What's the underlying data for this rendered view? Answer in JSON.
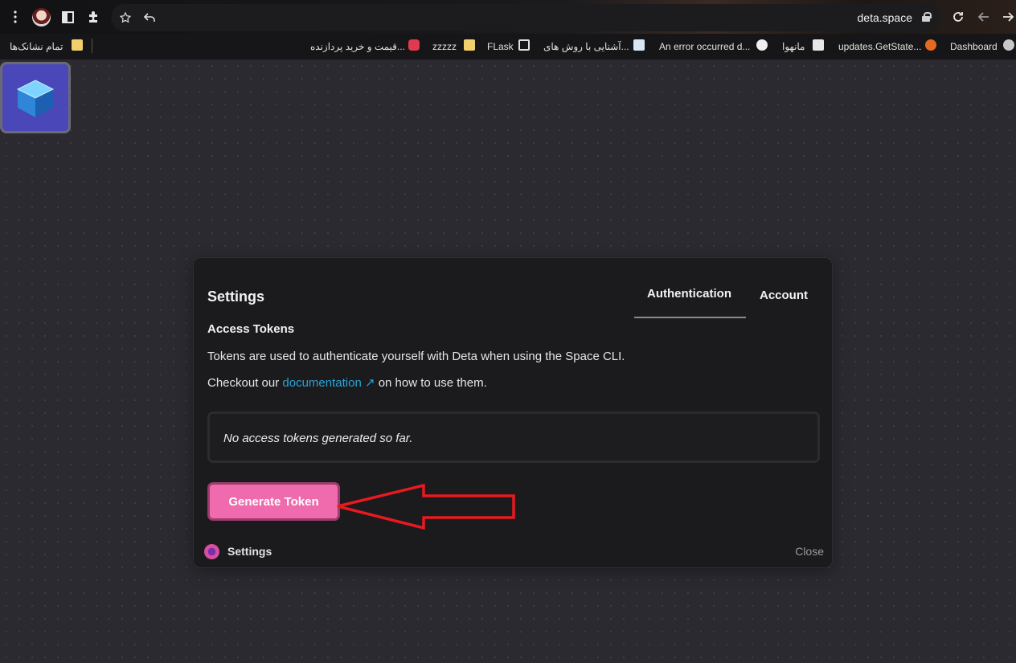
{
  "browser": {
    "url": "deta.space",
    "bookmarks": [
      {
        "label": "تمام نشانک‌ها",
        "icon": "folder-icon"
      },
      {
        "label": "قیمت و خرید پردازنده...",
        "icon": "site-favicon"
      },
      {
        "label": "zzzzz",
        "icon": "folder-icon"
      },
      {
        "label": "FLask",
        "icon": "page-icon"
      },
      {
        "label": "آشنایی با روش های...",
        "icon": "site-favicon"
      },
      {
        "label": "An error occurred d...",
        "icon": "github-icon"
      },
      {
        "label": "مانهوا",
        "icon": "site-favicon"
      },
      {
        "label": "updates.GetState...",
        "icon": "firefox-icon"
      },
      {
        "label": "Dashboard",
        "icon": "site-favicon"
      }
    ]
  },
  "settings": {
    "title": "Settings",
    "tabs": [
      {
        "label": "Authentication",
        "active": true
      },
      {
        "label": "Account",
        "active": false
      }
    ],
    "section_title": "Access Tokens",
    "description_line1": "Tokens are used to authenticate yourself with Deta when using the Space CLI.",
    "description_prefix": "Checkout our",
    "description_link": "documentation ↗",
    "description_suffix": "on how to use them.",
    "empty_message": "No access tokens generated so far.",
    "generate_button": "Generate Token",
    "footer_label": "Settings",
    "close_label": "Close"
  },
  "colors": {
    "accent": "#f06bad",
    "link": "#2aa3d8",
    "annotation_arrow": "#e8191f"
  }
}
